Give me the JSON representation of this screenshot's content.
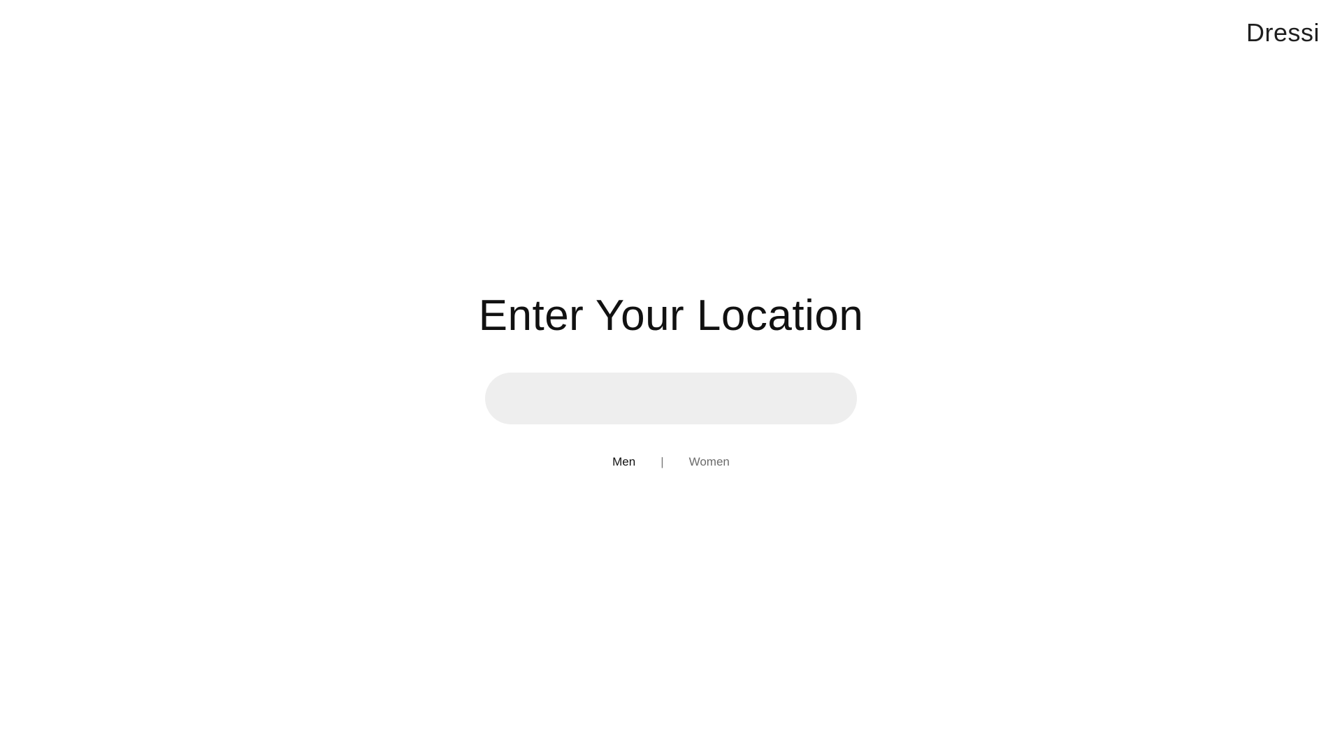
{
  "header": {
    "brand": "Dressi"
  },
  "main": {
    "title": "Enter Your Location",
    "location_input": {
      "value": "",
      "placeholder": ""
    },
    "gender_toggle": {
      "options": [
        "Men",
        "Women"
      ],
      "selected": "Men",
      "separator": "|"
    }
  },
  "colors": {
    "background": "#ffffff",
    "input_background": "#eeeeee",
    "text_primary": "#111111",
    "text_muted": "#6b6b6b"
  }
}
